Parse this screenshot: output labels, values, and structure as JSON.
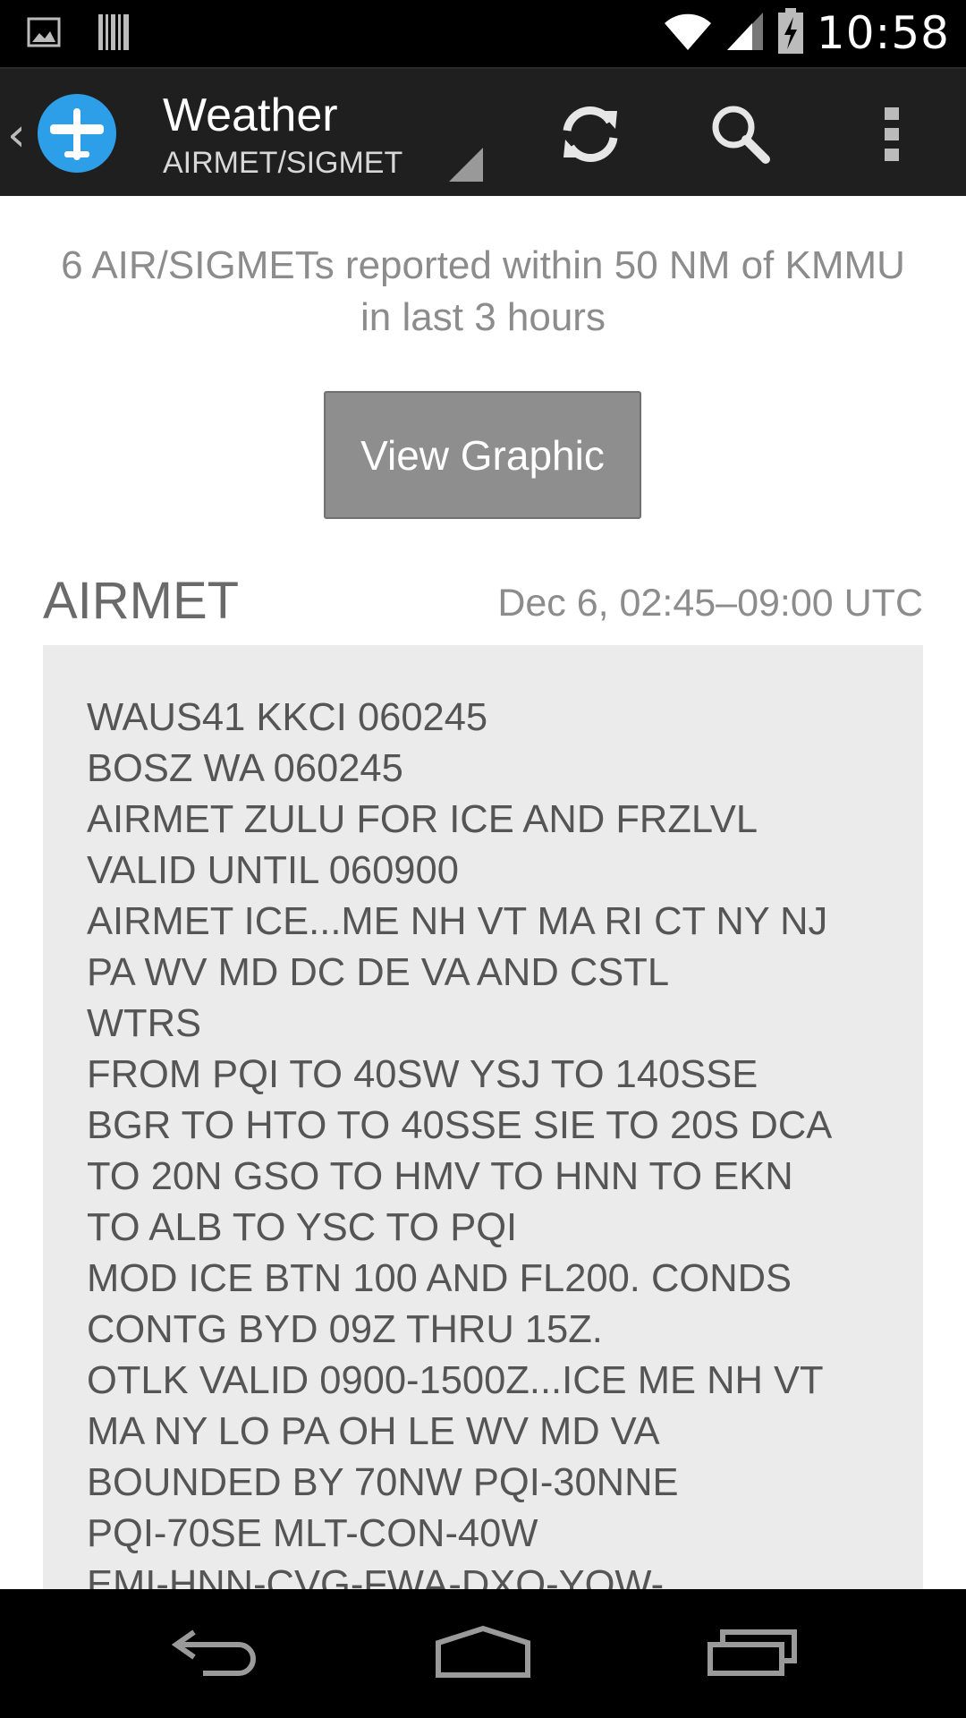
{
  "status_bar": {
    "time": "10:58",
    "icons": [
      "image-icon",
      "barcode-icon",
      "wifi-icon",
      "signal-icon",
      "battery-charging-icon"
    ]
  },
  "action_bar": {
    "title": "Weather",
    "subtitle": "AIRMET/SIGMET",
    "icons": [
      "back-chevron-icon",
      "airplane-logo-icon",
      "refresh-icon",
      "search-icon",
      "overflow-menu-icon"
    ]
  },
  "summary_text": "6 AIR/SIGMETs reported within 50 NM of KMMU in last 3 hours",
  "view_graphic_label": "View Graphic",
  "section": {
    "title": "AIRMET",
    "time_range": "Dec 6, 02:45–09:00 UTC"
  },
  "report_lines": [
    "WAUS41 KKCI 060245",
    "BOSZ WA 060245",
    "AIRMET ZULU FOR ICE AND FRZLVL",
    "VALID UNTIL 060900",
    "AIRMET ICE...ME NH VT MA RI CT NY NJ",
    "PA WV MD DC DE VA AND CSTL",
    "WTRS",
    "FROM PQI TO 40SW YSJ TO 140SSE",
    "BGR TO HTO TO 40SSE SIE TO 20S DCA",
    "TO 20N GSO TO HMV TO HNN TO EKN",
    "TO ALB TO YSC TO PQI",
    "MOD ICE BTN 100 AND FL200. CONDS",
    "CONTG BYD 09Z THRU 15Z.",
    "OTLK VALID 0900-1500Z...ICE ME NH VT",
    "MA NY LO PA OH LE WV MD VA",
    "BOUNDED BY 70NW PQI-30NNE",
    "PQI-70SE MLT-CON-40W",
    "EMI-HNN-CVG-FWA-DXO-YOW-"
  ],
  "nav_bar": {
    "icons": [
      "back-icon",
      "home-icon",
      "recents-icon"
    ]
  }
}
